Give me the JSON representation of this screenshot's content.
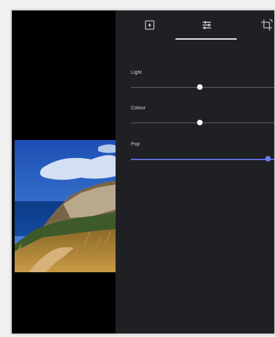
{
  "toolbar": {
    "tools": [
      {
        "icon": "auto-enhance-icon"
      },
      {
        "icon": "adjustments-icon",
        "selected": true
      },
      {
        "icon": "crop-rotate-icon"
      }
    ]
  },
  "adjustments": [
    {
      "label": "Light",
      "value": 0.5
    },
    {
      "label": "Colour",
      "value": 0.5
    },
    {
      "label": "Pop",
      "value": 1.0
    }
  ],
  "colors": {
    "panel_bg": "#1f2023",
    "accent": "#5c6ed9",
    "track": "#5d5f63"
  }
}
